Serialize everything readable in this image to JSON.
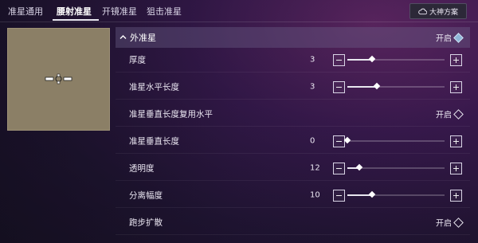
{
  "tabs": [
    {
      "label": "准星通用",
      "active": false
    },
    {
      "label": "腰射准星",
      "active": true
    },
    {
      "label": "开镜准星",
      "active": false
    },
    {
      "label": "狙击准星",
      "active": false
    }
  ],
  "dashen_button": {
    "label": "大神方案",
    "icon": "cloud-icon"
  },
  "preview": {
    "crosshair_icon": "crosshair-icon"
  },
  "section": {
    "title": "外准星",
    "toggle_text": "开启",
    "enabled": true
  },
  "settings": [
    {
      "key": "thickness",
      "label": "厚度",
      "type": "slider",
      "value": "3",
      "fraction": 0.25
    },
    {
      "key": "h_length",
      "label": "准星水平长度",
      "type": "slider",
      "value": "3",
      "fraction": 0.3
    },
    {
      "key": "v_reuse",
      "label": "准星垂直长度复用水平",
      "type": "toggle",
      "toggle_text": "开启",
      "enabled": false
    },
    {
      "key": "v_length",
      "label": "准星垂直长度",
      "type": "slider",
      "value": "0",
      "fraction": 0.0
    },
    {
      "key": "opacity",
      "label": "透明度",
      "type": "slider",
      "value": "12",
      "fraction": 0.12
    },
    {
      "key": "spread",
      "label": "分离幅度",
      "type": "slider",
      "value": "10",
      "fraction": 0.25
    },
    {
      "key": "run_spread",
      "label": "跑步扩散",
      "type": "toggle",
      "toggle_text": "开启",
      "enabled": false
    }
  ],
  "colors": {
    "accent_on": "#8fb7d9",
    "preview_bg": "#8b7f66"
  }
}
